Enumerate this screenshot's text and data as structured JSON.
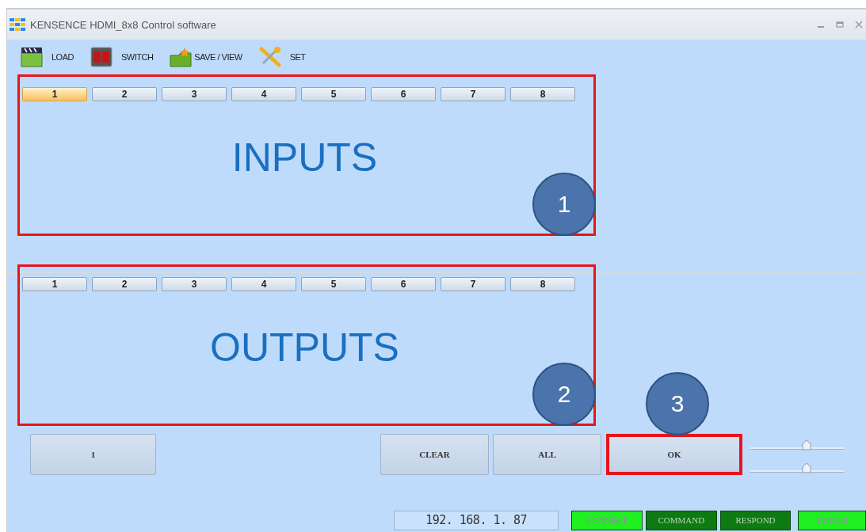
{
  "window": {
    "title": "KENSENCE HDMI_8x8 Control software"
  },
  "toolbar": [
    {
      "kind": "load",
      "label": "LOAD"
    },
    {
      "kind": "switch",
      "label": "SWITCH"
    },
    {
      "kind": "save",
      "label": "SAVE / VIEW"
    },
    {
      "kind": "set",
      "label": "SET"
    }
  ],
  "panels": [
    {
      "title": "INPUTS",
      "highlighted": true,
      "badge": "1",
      "channels": [
        {
          "label": "1",
          "selected": true
        },
        {
          "label": "2",
          "selected": false
        },
        {
          "label": "3",
          "selected": false
        },
        {
          "label": "4",
          "selected": false
        },
        {
          "label": "5",
          "selected": false
        },
        {
          "label": "6",
          "selected": false
        },
        {
          "label": "7",
          "selected": false
        },
        {
          "label": "8",
          "selected": false
        }
      ]
    },
    {
      "title": "OUTPUTS",
      "highlighted": true,
      "badge": "2",
      "channels": [
        {
          "label": "1",
          "selected": false
        },
        {
          "label": "2",
          "selected": false
        },
        {
          "label": "3",
          "selected": false
        },
        {
          "label": "4",
          "selected": false
        },
        {
          "label": "5",
          "selected": false
        },
        {
          "label": "6",
          "selected": false
        },
        {
          "label": "7",
          "selected": false
        },
        {
          "label": "8",
          "selected": false
        }
      ]
    }
  ],
  "buttons": [
    {
      "label": "1",
      "highlighted": false
    },
    {
      "label": "CLEAR",
      "highlighted": false
    },
    {
      "label": "ALL",
      "highlighted": false
    },
    {
      "label": "OK",
      "highlighted": true,
      "badge": "3"
    }
  ],
  "sliders": [
    {
      "level": 0.6
    },
    {
      "level": 0.6
    }
  ],
  "status_bar": {
    "ip": "192. 168. 1. 87",
    "indicators": [
      {
        "label": "CONNECT",
        "on": true
      },
      {
        "label": "COMMAND",
        "on": false
      },
      {
        "label": "RESPOND",
        "on": false
      },
      {
        "label": "STATUS",
        "on": true
      }
    ]
  }
}
